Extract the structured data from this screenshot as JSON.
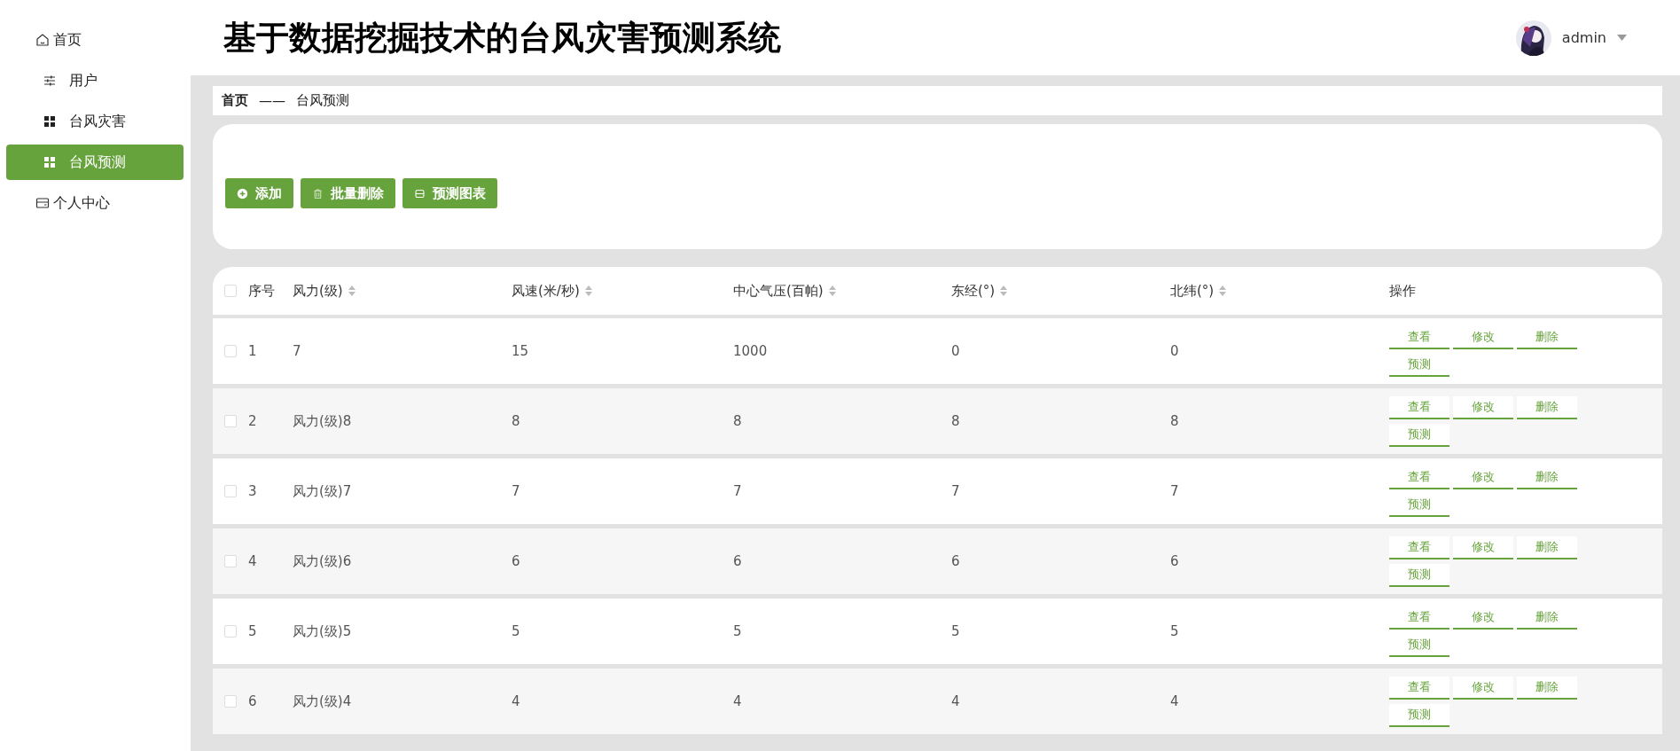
{
  "sidebar": {
    "items": [
      {
        "label": "首页",
        "kind": "top",
        "selected": false
      },
      {
        "label": "用户",
        "kind": "sub",
        "selected": false
      },
      {
        "label": "台风灾害",
        "kind": "sub",
        "selected": false
      },
      {
        "label": "台风预测",
        "kind": "sub",
        "selected": true
      },
      {
        "label": "个人中心",
        "kind": "top",
        "selected": false
      }
    ]
  },
  "header": {
    "title": "基于数据挖掘技术的台风灾害预测系统",
    "user": "admin"
  },
  "breadcrumb": [
    "首页",
    "——",
    "台风预测"
  ],
  "toolbar": [
    {
      "label": "添加"
    },
    {
      "label": "批量删除"
    },
    {
      "label": "预测图表"
    }
  ],
  "table": {
    "all_checked": false,
    "columns": [
      {
        "label": "序号",
        "sortable": false
      },
      {
        "label": "风力(级)",
        "sortable": true
      },
      {
        "label": "风速(米/秒)",
        "sortable": true
      },
      {
        "label": "中心气压(百帕)",
        "sortable": true
      },
      {
        "label": "东经(°)",
        "sortable": true
      },
      {
        "label": "北纬(°)",
        "sortable": true
      },
      {
        "label": "操作",
        "sortable": false
      }
    ],
    "rows": [
      {
        "checked": false,
        "cells": [
          "1",
          "7",
          "15",
          "1000",
          "0",
          "0"
        ],
        "actions": [
          "查看",
          "修改",
          "删除",
          "预测"
        ]
      },
      {
        "checked": false,
        "cells": [
          "2",
          "风力(级)8",
          "8",
          "8",
          "8",
          "8"
        ],
        "actions": [
          "查看",
          "修改",
          "删除",
          "预测"
        ]
      },
      {
        "checked": false,
        "cells": [
          "3",
          "风力(级)7",
          "7",
          "7",
          "7",
          "7"
        ],
        "actions": [
          "查看",
          "修改",
          "删除",
          "预测"
        ]
      },
      {
        "checked": false,
        "cells": [
          "4",
          "风力(级)6",
          "6",
          "6",
          "6",
          "6"
        ],
        "actions": [
          "查看",
          "修改",
          "删除",
          "预测"
        ]
      },
      {
        "checked": false,
        "cells": [
          "5",
          "风力(级)5",
          "5",
          "5",
          "5",
          "5"
        ],
        "actions": [
          "查看",
          "修改",
          "删除",
          "预测"
        ]
      },
      {
        "checked": false,
        "cells": [
          "6",
          "风力(级)4",
          "4",
          "4",
          "4",
          "4"
        ],
        "actions": [
          "查看",
          "修改",
          "删除",
          "预测"
        ]
      }
    ]
  }
}
